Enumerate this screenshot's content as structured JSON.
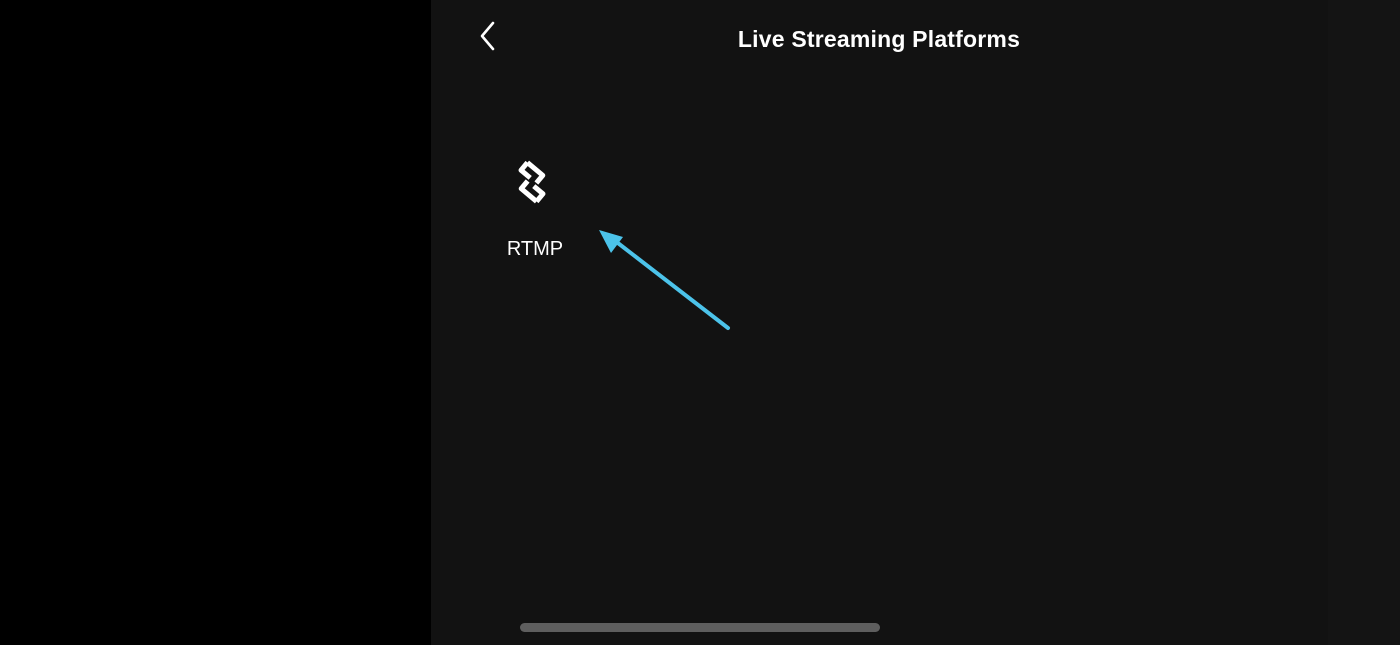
{
  "header": {
    "title": "Live Streaming Platforms",
    "back_icon": "chevron-left-icon"
  },
  "platforms": [
    {
      "label": "RTMP",
      "icon": "link-icon"
    }
  ],
  "annotation": {
    "arrow_color": "#4cc3ea",
    "arrow_icon": "arrow-pointer-icon"
  },
  "colors": {
    "panel_background": "#121212",
    "outer_background": "#000000",
    "text": "#ffffff",
    "home_indicator": "#5e5e5e"
  }
}
